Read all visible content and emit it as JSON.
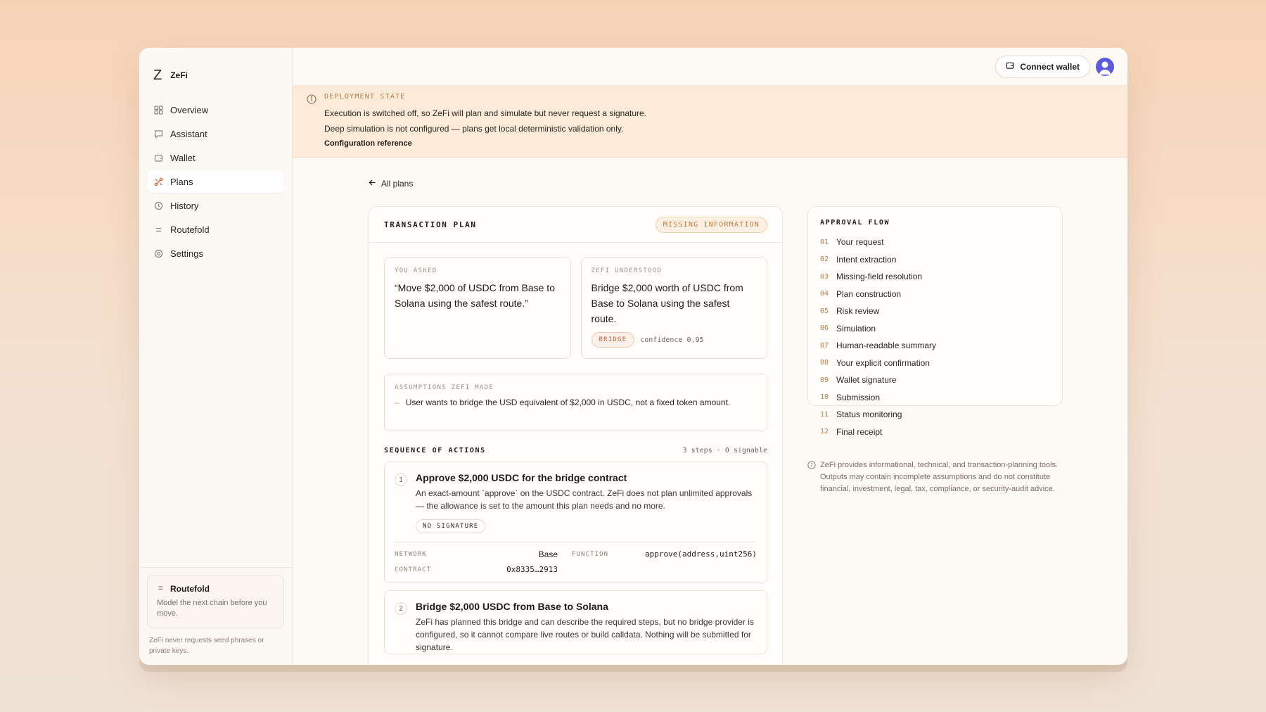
{
  "brand": {
    "logo": "Z",
    "name": "ZeFi"
  },
  "sidebar": {
    "items": [
      {
        "label": "Overview",
        "icon": "grid-icon"
      },
      {
        "label": "Assistant",
        "icon": "chat-icon"
      },
      {
        "label": "Wallet",
        "icon": "wallet-icon"
      },
      {
        "label": "Plans",
        "icon": "plans-icon",
        "active": true
      },
      {
        "label": "History",
        "icon": "history-icon"
      },
      {
        "label": "Routefold",
        "icon": "routefold-icon"
      },
      {
        "label": "Settings",
        "icon": "gear-icon"
      }
    ],
    "routefold_card": {
      "title": "Routefold",
      "description": "Model the next chain before you move."
    },
    "note": "ZeFi never requests seed phrases or private keys."
  },
  "header": {
    "connect_label": "Connect wallet"
  },
  "banner": {
    "label": "DEPLOYMENT STATE",
    "line1": "Execution is switched off, so ZeFi will plan and simulate but never request a signature.",
    "line2": "Deep simulation is not configured — plans get local deterministic validation only.",
    "link": "Configuration reference"
  },
  "back_label": "All plans",
  "plan": {
    "title": "TRANSACTION PLAN",
    "status": "MISSING INFORMATION",
    "asked_label": "YOU ASKED",
    "asked_text": "“Move $2,000 of USDC from Base to Solana using the safest route.”",
    "understood_label": "ZEFI UNDERSTOOD",
    "understood_text": "Bridge $2,000 worth of USDC from Base to Solana using the safest route.",
    "intent_badge": "BRIDGE",
    "confidence": "confidence 0.95",
    "assumptions_label": "ASSUMPTIONS ZEFI MADE",
    "assumptions": [
      "User wants to bridge the USD equivalent of $2,000 in USDC, not a fixed token amount."
    ],
    "sequence_title": "SEQUENCE OF ACTIONS",
    "sequence_meta": "3 steps · 0 signable",
    "steps": [
      {
        "num": "1",
        "title": "Approve $2,000 USDC for the bridge contract",
        "description": "An exact-amount `approve` on the USDC contract. ZeFi does not plan unlimited approvals — the allowance is set to the amount this plan needs and no more.",
        "badge": "NO SIGNATURE",
        "network_label": "NETWORK",
        "network": "Base",
        "function_label": "FUNCTION",
        "function": "approve(address,uint256)",
        "contract_label": "CONTRACT",
        "contract": "0x8335…2913"
      },
      {
        "num": "2",
        "title": "Bridge $2,000 USDC from Base to Solana",
        "description": "ZeFi has planned this bridge and can describe the required steps, but no bridge provider is configured, so it cannot compare live routes or build calldata. Nothing will be submitted for signature."
      }
    ]
  },
  "approval_flow": {
    "title": "APPROVAL FLOW",
    "items": [
      {
        "num": "01",
        "label": "Your request"
      },
      {
        "num": "02",
        "label": "Intent extraction"
      },
      {
        "num": "03",
        "label": "Missing-field resolution"
      },
      {
        "num": "04",
        "label": "Plan construction"
      },
      {
        "num": "05",
        "label": "Risk review"
      },
      {
        "num": "06",
        "label": "Simulation"
      },
      {
        "num": "07",
        "label": "Human-readable summary"
      },
      {
        "num": "08",
        "label": "Your explicit confirmation"
      },
      {
        "num": "09",
        "label": "Wallet signature"
      },
      {
        "num": "10",
        "label": "Submission"
      },
      {
        "num": "11",
        "label": "Status monitoring"
      },
      {
        "num": "12",
        "label": "Final receipt"
      }
    ]
  },
  "disclaimer": "ZeFi provides informational, technical, and transaction-planning tools. Outputs may contain incomplete assumptions and do not constitute financial, investment, legal, tax, compliance, or security-audit advice.",
  "colors": {
    "accent": "#d4683a",
    "banner_bg": "#fbebd8",
    "status_badge": "#c07a40",
    "avatar": "#5c5be0"
  }
}
